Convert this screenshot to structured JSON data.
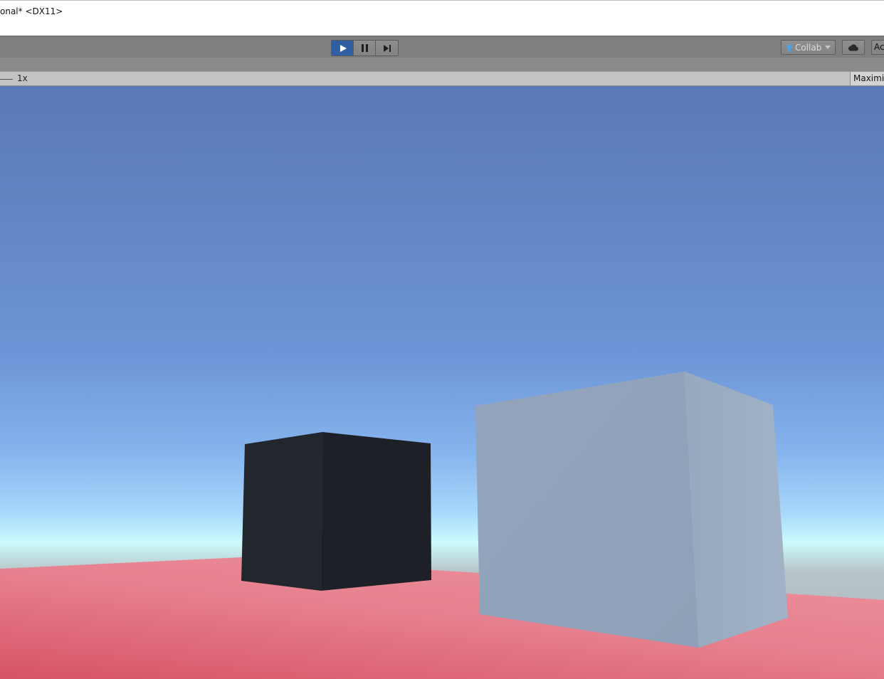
{
  "window": {
    "title": "onal* <DX11>"
  },
  "toolbar": {
    "collab_label": "Collab",
    "account_label": "Ac",
    "icons": [
      "play-icon",
      "pause-icon",
      "step-icon",
      "up-arrow-icon",
      "cloud-icon"
    ],
    "colors": {
      "active_play": "#2f5fa0",
      "collab_arrow": "#4fa3e3"
    }
  },
  "game_view": {
    "scale_label": "1x",
    "maximize_label": "Maximiz"
  },
  "scene": {
    "sky_top": "#5a79b6",
    "sky_horizon": "#c9fbfb",
    "ground": "#de6474",
    "dark_cube": "#1e232b",
    "light_cube": "#94a6bd"
  }
}
